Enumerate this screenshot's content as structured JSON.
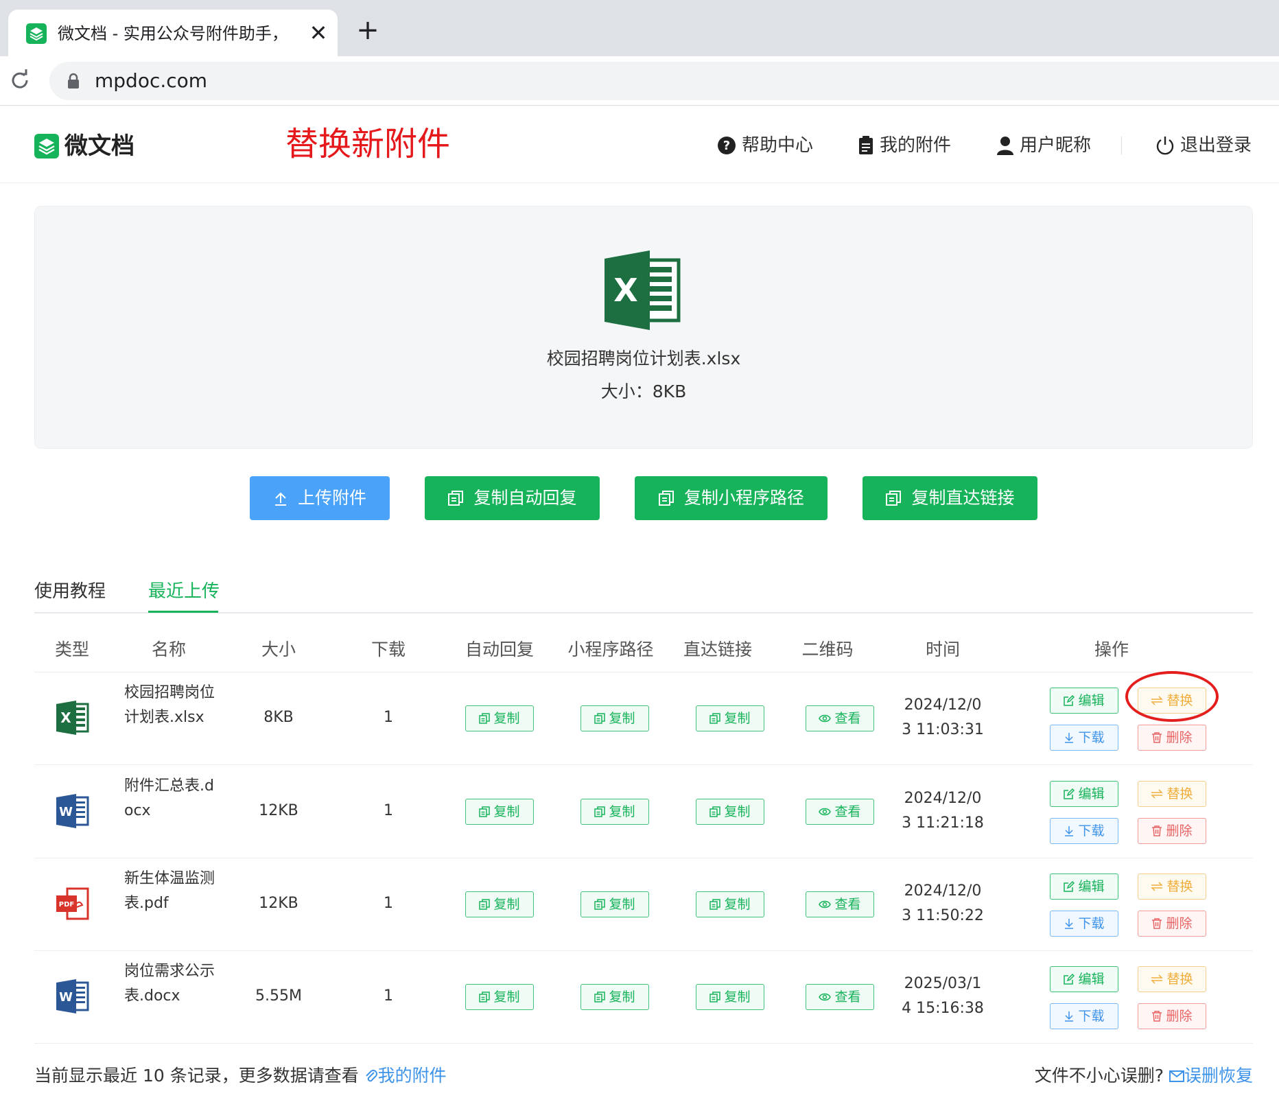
{
  "browser": {
    "tab_title": "微文档 - 实用公众号附件助手，",
    "close_glyph": "✕",
    "new_tab_glyph": "+",
    "url": "mpdoc.com"
  },
  "header": {
    "logo_text": "微文档",
    "heading": "替换新附件",
    "nav": {
      "help": "帮助中心",
      "attachments": "我的附件",
      "user": "用户昵称",
      "logout": "退出登录"
    }
  },
  "preview": {
    "file_name": "校园招聘岗位计划表.xlsx",
    "file_size": "大小：8KB"
  },
  "actions": {
    "upload": "上传附件",
    "copy_reply": "复制自动回复",
    "copy_path": "复制小程序路径",
    "copy_link": "复制直达链接"
  },
  "tabs": {
    "tutorial": "使用教程",
    "recent": "最近上传"
  },
  "table": {
    "headers": {
      "type": "类型",
      "name": "名称",
      "size": "大小",
      "downloads": "下载",
      "auto_reply": "自动回复",
      "mini_path": "小程序路径",
      "direct_link": "直达链接",
      "qrcode": "二维码",
      "time": "时间",
      "ops": "操作"
    },
    "button_labels": {
      "copy": "复制",
      "view": "查看",
      "edit": "编辑",
      "replace": "替换",
      "download": "下载",
      "delete": "删除"
    },
    "rows": [
      {
        "type": "xlsx",
        "name": "校园招聘岗位计划表.xlsx",
        "size": "8KB",
        "downloads": "1",
        "time_line1": "2024/12/0",
        "time_line2": "3 11:03:31"
      },
      {
        "type": "docx",
        "name": "附件汇总表.docx",
        "size": "12KB",
        "downloads": "1",
        "time_line1": "2024/12/0",
        "time_line2": "3 11:21:18"
      },
      {
        "type": "pdf",
        "name": "新生体温监测表.pdf",
        "size": "12KB",
        "downloads": "1",
        "time_line1": "2024/12/0",
        "time_line2": "3 11:50:22"
      },
      {
        "type": "docx",
        "name": "岗位需求公示表.docx",
        "size": "5.55M",
        "downloads": "1",
        "time_line1": "2025/03/1",
        "time_line2": "4 15:16:38"
      }
    ]
  },
  "footer": {
    "left_text": "当前显示最近 10 条记录，更多数据请查看",
    "left_link": "我的附件",
    "right_text": "文件不小心误删?",
    "right_link": "误删恢复"
  },
  "colors": {
    "brand_green": "#16b35a",
    "upload_blue": "#4aa3f8",
    "heading_red": "#e5191c",
    "replace_orange": "#efae3c",
    "delete_red": "#e96363"
  }
}
